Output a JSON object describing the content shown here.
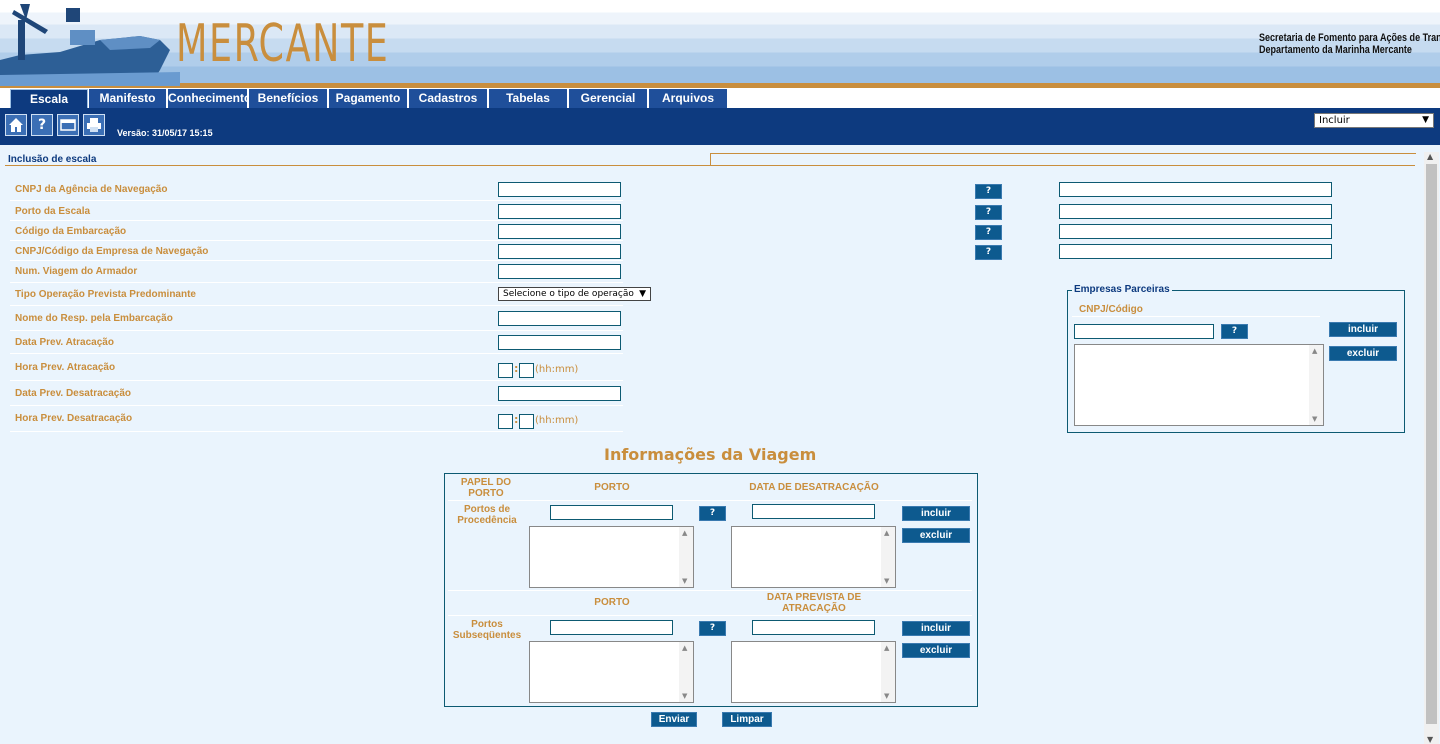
{
  "header": {
    "logo_text": "MERCANTE",
    "secretaria": "Secretaria de Fomento para Ações de Transportes",
    "departamento": "Departamento da Marinha Mercante"
  },
  "nav": {
    "tabs": [
      {
        "label": "Escala",
        "active": true
      },
      {
        "label": "Manifesto"
      },
      {
        "label": "Conhecimento"
      },
      {
        "label": "Benefícios"
      },
      {
        "label": "Pagamento"
      },
      {
        "label": "Cadastros"
      },
      {
        "label": "Tabelas"
      },
      {
        "label": "Gerencial"
      },
      {
        "label": "Arquivos"
      }
    ]
  },
  "toolbar": {
    "icons": [
      "home-icon",
      "help-icon",
      "window-icon",
      "print-icon"
    ],
    "versao": "Versão: 31/05/17 15:15",
    "action_select": "Incluir"
  },
  "form": {
    "section_title": "Inclusão de escala",
    "fields": [
      "CNPJ da Agência de Navegação",
      "Porto da Escala",
      "Código da Embarcação",
      "CNPJ/Código da Empresa de Navegação",
      "Num. Viagem do Armador",
      "Tipo Operação Prevista Predominante",
      "Nome do Resp. pela Embarcação",
      "Data Prev. Atracação",
      "Hora Prev. Atracação",
      "Data Prev. Desatracação",
      "Hora Prev. Desatracação"
    ],
    "tipo_operacao_select": "Selecione o tipo de operação",
    "hhmm": "(hh:mm)",
    "lookup_label": "?"
  },
  "empresas": {
    "legend": "Empresas Parceiras",
    "sub": "CNPJ/Código",
    "incluir": "incluir",
    "excluir": "excluir",
    "lookup": "?"
  },
  "viagem": {
    "title": "Informações da Viagem",
    "papel_do_porto": "PAPEL DO PORTO",
    "porto": "PORTO",
    "data_desatracacao": "DATA DE DESATRACAÇÃO",
    "data_prevista_atracacao": "DATA PREVISTA DE ATRACAÇÃO",
    "portos_procedencia": "Portos de Procedência",
    "portos_subsequentes": "Portos Subseqüentes",
    "incluir": "incluir",
    "excluir": "excluir",
    "lookup": "?"
  },
  "actions": {
    "enviar": "Enviar",
    "limpar": "Limpar"
  }
}
